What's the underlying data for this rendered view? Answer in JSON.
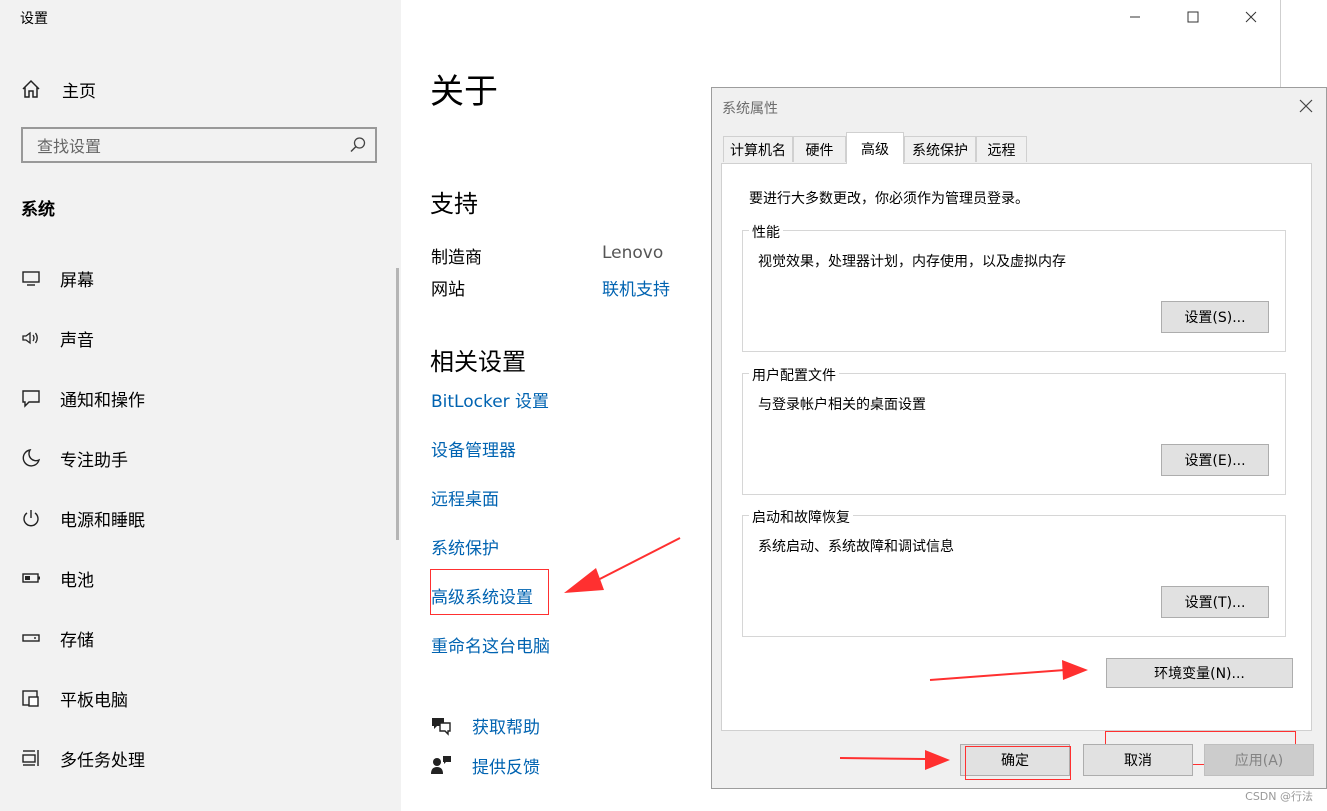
{
  "window": {
    "title": "设置"
  },
  "left": {
    "home_label": "主页",
    "search_placeholder": "查找设置",
    "section_title": "系统",
    "nav": [
      {
        "label": "屏幕",
        "icon": "display-icon"
      },
      {
        "label": "声音",
        "icon": "speaker-icon"
      },
      {
        "label": "通知和操作",
        "icon": "notification-icon"
      },
      {
        "label": "专注助手",
        "icon": "moon-icon"
      },
      {
        "label": "电源和睡眠",
        "icon": "power-icon"
      },
      {
        "label": "电池",
        "icon": "battery-icon"
      },
      {
        "label": "存储",
        "icon": "storage-icon"
      },
      {
        "label": "平板电脑",
        "icon": "tablet-icon"
      },
      {
        "label": "多任务处理",
        "icon": "multitask-icon"
      }
    ]
  },
  "main": {
    "title": "关于",
    "support_title": "支持",
    "manufacturer_label": "制造商",
    "manufacturer_value": "Lenovo",
    "website_label": "网站",
    "website_value": "联机支持",
    "related_title": "相关设置",
    "related_links": [
      "BitLocker 设置",
      "设备管理器",
      "远程桌面",
      "系统保护",
      "高级系统设置",
      "重命名这台电脑"
    ],
    "help_label": "获取帮助",
    "feedback_label": "提供反馈"
  },
  "dialog": {
    "title": "系统属性",
    "tabs": [
      "计算机名",
      "硬件",
      "高级",
      "系统保护",
      "远程"
    ],
    "active_tab": "高级",
    "admin_note": "要进行大多数更改，你必须作为管理员登录。",
    "groups": [
      {
        "title": "性能",
        "desc": "视觉效果，处理器计划，内存使用，以及虚拟内存",
        "button": "设置(S)..."
      },
      {
        "title": "用户配置文件",
        "desc": "与登录帐户相关的桌面设置",
        "button": "设置(E)..."
      },
      {
        "title": "启动和故障恢复",
        "desc": "系统启动、系统故障和调试信息",
        "button": "设置(T)..."
      }
    ],
    "env_button": "环境变量(N)...",
    "ok": "确定",
    "cancel": "取消",
    "apply": "应用(A)"
  },
  "watermark": "CSDN @行法",
  "colors": {
    "link": "#0063b1",
    "annotation": "#ff3030",
    "sidebar_bg": "#f2f2f2",
    "dialog_bg": "#f0f0f0"
  }
}
